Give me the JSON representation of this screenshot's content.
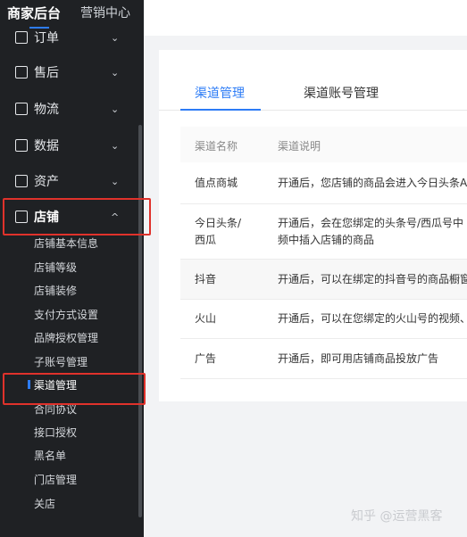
{
  "header": {
    "brand": "商家后台",
    "brand_sub": "营销中心"
  },
  "sidebar": {
    "items": [
      {
        "label": "订单",
        "icon": "order-icon"
      },
      {
        "label": "售后",
        "icon": "aftersale-icon"
      },
      {
        "label": "物流",
        "icon": "truck-icon"
      },
      {
        "label": "数据",
        "icon": "chart-icon"
      },
      {
        "label": "资产",
        "icon": "wallet-icon"
      },
      {
        "label": "店铺",
        "icon": "store-icon"
      }
    ],
    "chevron_down": "⌄",
    "chevron_up": "^",
    "store_sub": [
      "店铺基本信息",
      "店铺等级",
      "店铺装修",
      "支付方式设置",
      "品牌授权管理",
      "子账号管理",
      "渠道管理",
      "合同协议",
      "接口授权",
      "黑名单",
      "门店管理",
      "关店"
    ]
  },
  "main": {
    "tabs": [
      "渠道管理",
      "渠道账号管理"
    ],
    "table": {
      "columns": [
        "渠道名称",
        "渠道说明"
      ],
      "rows": [
        {
          "name": "值点商城",
          "desc": "开通后，您店铺的商品会进入今日头条A"
        },
        {
          "name": "今日头条/\n西瓜",
          "desc": "开通后，会在您绑定的头条号/西瓜号中\n频中插入店铺的商品"
        },
        {
          "name": "抖音",
          "desc": "开通后，可以在绑定的抖音号的商品橱窗"
        },
        {
          "name": "火山",
          "desc": "开通后，可以在您绑定的火山号的视频、"
        },
        {
          "name": "广告",
          "desc": "开通后，即可用店铺商品投放广告"
        }
      ]
    }
  },
  "watermark": "知乎 @运营黑客",
  "colors": {
    "accent": "#2d7cf6",
    "highlight": "#e0322b",
    "sidebar_bg": "#1f2124"
  }
}
